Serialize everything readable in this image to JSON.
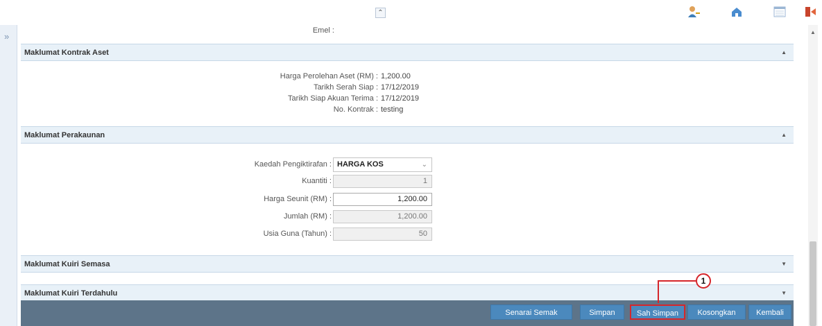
{
  "top_icons": [
    "chevrons-up-icon",
    "user-key-icon",
    "home-icon",
    "calendar-icon",
    "logout-icon"
  ],
  "sidebar": {
    "expand_glyph": "»"
  },
  "email_row": {
    "label": "Emel :"
  },
  "kontrak": {
    "title": "Maklumat Kontrak Aset",
    "fields": [
      {
        "label": "Harga Perolehan Aset (RM) :",
        "value": "1,200.00"
      },
      {
        "label": "Tarikh Serah Siap :",
        "value": "17/12/2019"
      },
      {
        "label": "Tarikh Siap Akuan Terima :",
        "value": "17/12/2019"
      },
      {
        "label": "No. Kontrak :",
        "value": "testing"
      }
    ]
  },
  "perakaunan": {
    "title": "Maklumat Perakaunan",
    "kaedah": {
      "label": "Kaedah Pengiktirafan :",
      "value": "HARGA KOS"
    },
    "kuantiti": {
      "label": "Kuantiti :",
      "value": "1"
    },
    "harga_seunit": {
      "label": "Harga Seunit (RM) :",
      "value": "1,200.00"
    },
    "jumlah": {
      "label": "Jumlah (RM) :",
      "value": "1,200.00"
    },
    "usia_guna": {
      "label": "Usia Guna (Tahun) :",
      "value": "50"
    }
  },
  "kuiri_semasa": {
    "title": "Maklumat Kuiri Semasa"
  },
  "kuiri_terdahulu": {
    "title": "Maklumat Kuiri Terdahulu"
  },
  "actions": {
    "senarai_semak": "Senarai Semak",
    "simpan": "Simpan",
    "sah_simpan": "Sah Simpan",
    "kosongkan": "Kosongkan",
    "kembali": "Kembali"
  },
  "annotation": {
    "number": "1"
  },
  "colors": {
    "section_header_bg": "#e8f1f8",
    "footer_bg": "#5d7489",
    "button_bg": "#4b89bd",
    "annotation_red": "#d5262b"
  }
}
